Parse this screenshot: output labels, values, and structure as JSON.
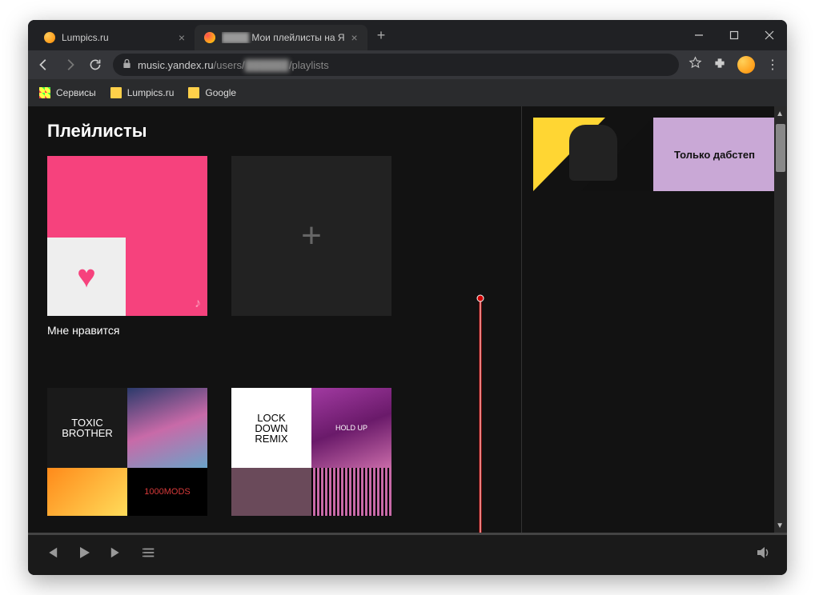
{
  "tabs": {
    "tab1_title": "Lumpics.ru",
    "tab2_blur": "████",
    "tab2_title": "Мои плейлисты на Я",
    "close": "×",
    "new": "+"
  },
  "addressbar": {
    "url_host": "music.yandex.ru",
    "url_path1": "/users/",
    "url_blur": "██████",
    "url_path2": "/playlists"
  },
  "bookmarks": {
    "b1": "Сервисы",
    "b2": "Lumpics.ru",
    "b3": "Google"
  },
  "page": {
    "heading": "Плейлисты",
    "liked_label": "Мне нравится",
    "add_symbol": "+",
    "heart_symbol": "♥",
    "note_symbol": "♪"
  },
  "grid": {
    "a1": "TOXIC BROTHER",
    "a4": "1000MODS",
    "b1a": "LOCK",
    "b1b": "DOWN",
    "b1c": "REMIX",
    "b2": "HOLD UP"
  },
  "sidebar": {
    "card_text": "Только дабстеп"
  }
}
